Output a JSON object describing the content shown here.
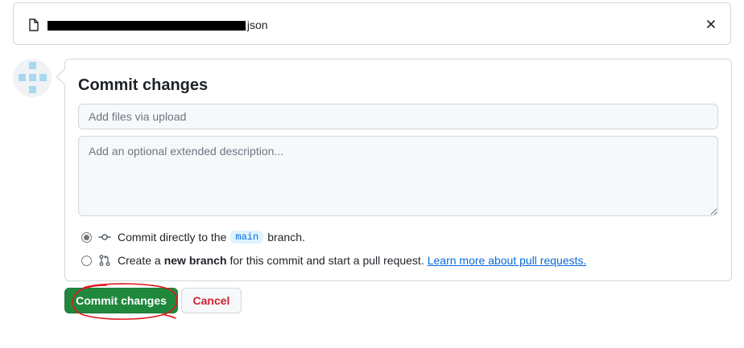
{
  "file": {
    "name_suffix": ".json",
    "icons": {
      "file": "file-icon",
      "close": "close-icon"
    }
  },
  "commit": {
    "title": "Commit changes",
    "summary_placeholder": "Add files via upload",
    "description_placeholder": "Add an optional extended description...",
    "option_direct": {
      "prefix": "Commit directly to the",
      "branch": "main",
      "suffix": "branch.",
      "selected": true
    },
    "option_new_branch": {
      "prefix": "Create a",
      "bold": "new branch",
      "suffix": "for this commit and start a pull request.",
      "link": "Learn more about pull requests.",
      "selected": false
    }
  },
  "actions": {
    "commit_label": "Commit changes",
    "cancel_label": "Cancel"
  },
  "colors": {
    "primary_button": "#1f883d",
    "cancel_text": "#cf222e",
    "link": "#0969da",
    "annotation": "#e0191c"
  }
}
